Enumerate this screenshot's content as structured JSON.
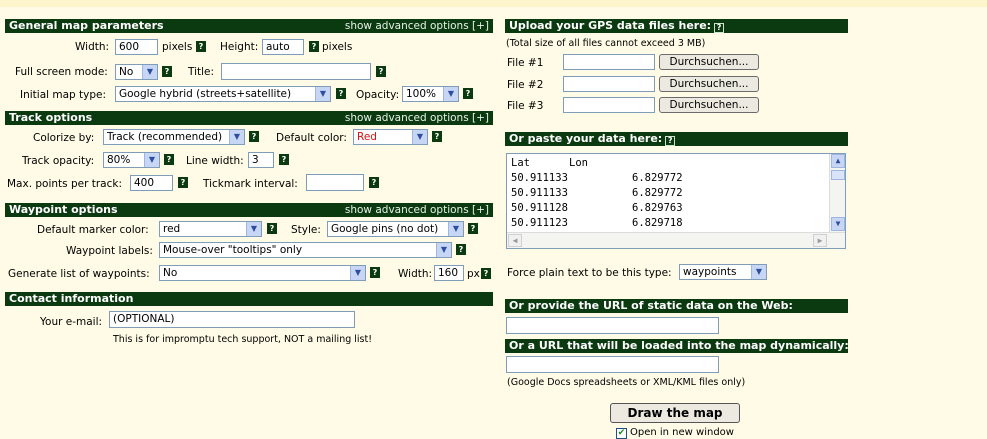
{
  "left": {
    "general": {
      "header": "General map parameters",
      "advanced": "show advanced options [+]",
      "width_label": "Width:",
      "width_value": "600",
      "width_unit": "pixels",
      "height_label": "Height:",
      "height_value": "auto",
      "height_unit": "pixels",
      "fullscreen_label": "Full screen mode:",
      "fullscreen_value": "No",
      "title_label": "Title:",
      "title_value": "",
      "maptype_label": "Initial map type:",
      "maptype_value": "Google hybrid (streets+satellite)",
      "opacity_label": "Opacity:",
      "opacity_value": "100%"
    },
    "track": {
      "header": "Track options",
      "advanced": "show advanced options [+]",
      "colorize_label": "Colorize by:",
      "colorize_value": "Track (recommended)",
      "default_color_label": "Default color:",
      "default_color_value": "Red",
      "opacity_label": "Track opacity:",
      "opacity_value": "80%",
      "linewidth_label": "Line width:",
      "linewidth_value": "3",
      "maxpoints_label": "Max. points per track:",
      "maxpoints_value": "400",
      "tickmark_label": "Tickmark interval:",
      "tickmark_value": ""
    },
    "waypoint": {
      "header": "Waypoint options",
      "advanced": "show advanced options [+]",
      "marker_color_label": "Default marker color:",
      "marker_color_value": "red",
      "style_label": "Style:",
      "style_value": "Google pins (no dot)",
      "labels_label": "Waypoint labels:",
      "labels_value": "Mouse-over \"tooltips\" only",
      "genlist_label": "Generate list of waypoints:",
      "genlist_value": "No",
      "width_label": "Width:",
      "width_value": "160",
      "width_unit": "px"
    },
    "contact": {
      "header": "Contact information",
      "email_label": "Your e-mail:",
      "email_value": "(OPTIONAL)",
      "note": "This is for impromptu tech support, NOT a mailing list!"
    }
  },
  "right": {
    "upload": {
      "header": "Upload your GPS data files here:",
      "note": "(Total size of all files cannot exceed 3 MB)",
      "files": [
        {
          "label": "File #1",
          "button": "Durchsuchen..."
        },
        {
          "label": "File #2",
          "button": "Durchsuchen..."
        },
        {
          "label": "File #3",
          "button": "Durchsuchen..."
        }
      ]
    },
    "paste": {
      "header": "Or paste your data here:",
      "col1": "Lat",
      "col2": "Lon",
      "rows": [
        {
          "lat": "50.911133",
          "lon": "6.829772"
        },
        {
          "lat": "50.911133",
          "lon": "6.829772"
        },
        {
          "lat": "50.911128",
          "lon": "6.829763"
        },
        {
          "lat": "50.911123",
          "lon": "6.829718"
        }
      ],
      "force_label": "Force plain text to be this type:",
      "force_value": "waypoints"
    },
    "url_static": {
      "header": "Or provide the URL of static data on the Web:",
      "value": ""
    },
    "url_dynamic": {
      "header": "Or a URL that will be loaded into the map dynamically:",
      "value": "",
      "note": "(Google Docs spreadsheets or XML/KML files only)"
    },
    "draw_button": "Draw the map",
    "open_new_window": "Open in new window",
    "open_new_window_checked": true
  },
  "glyphs": {
    "help": "?",
    "arrow": "▼",
    "check": "✔"
  },
  "colors": {
    "header_bg": "#0b3a10",
    "page_bg": "#fffbe6",
    "red_text": "#d01010"
  }
}
